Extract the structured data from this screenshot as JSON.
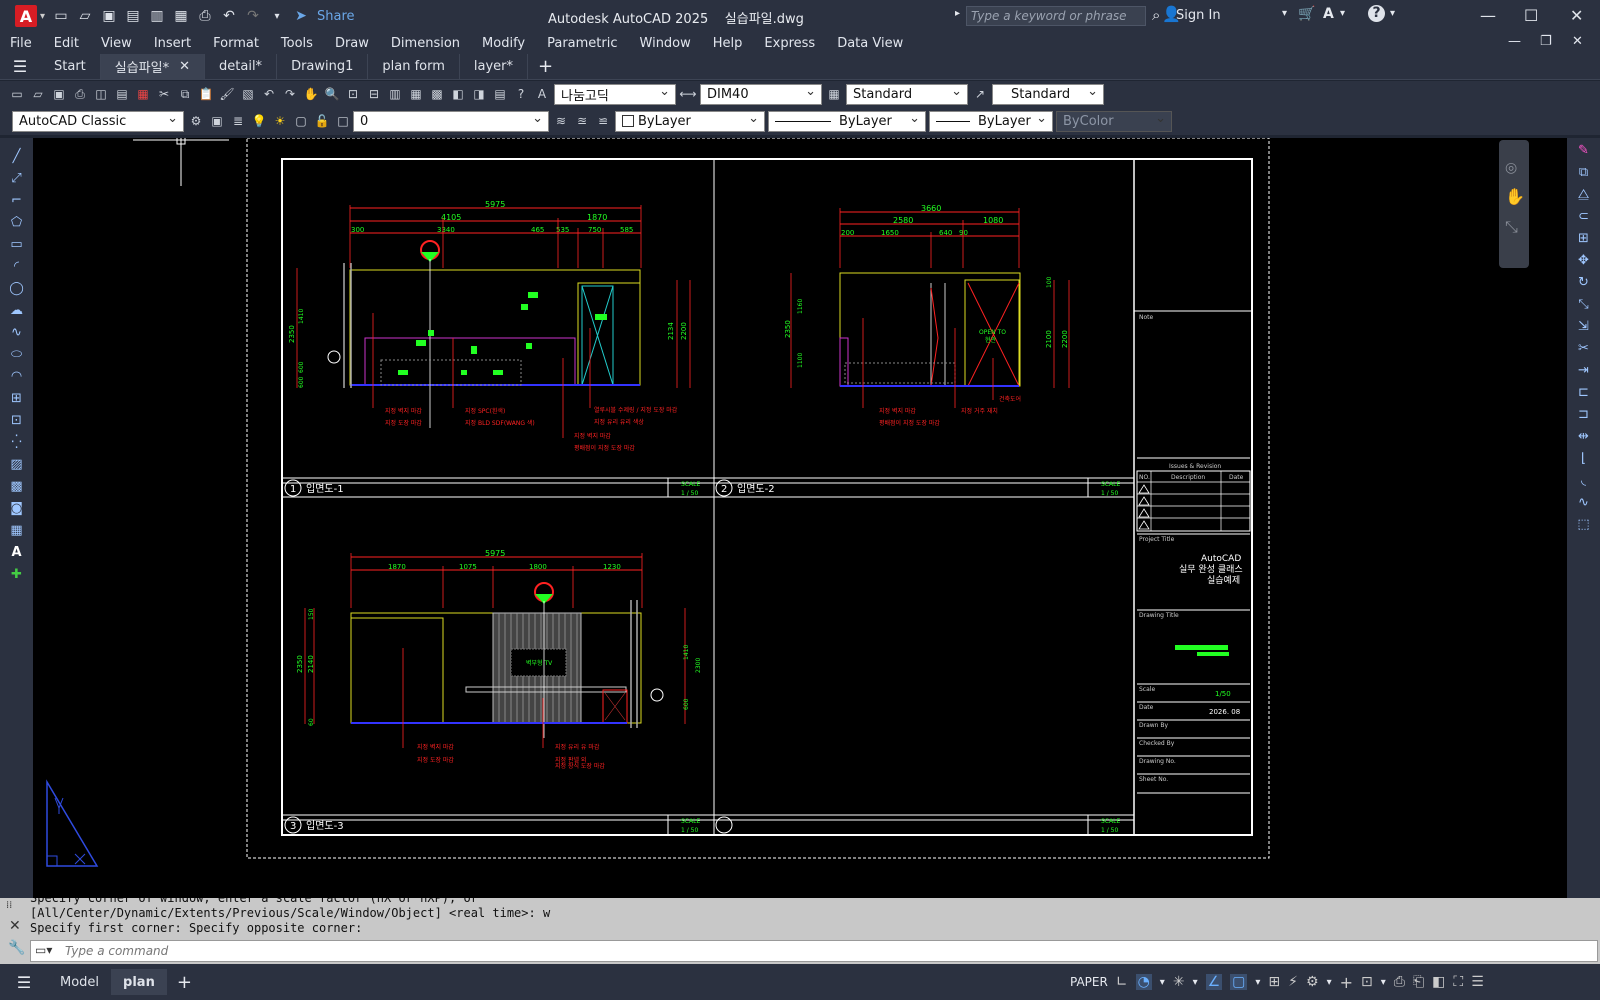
{
  "app": {
    "title": "Autodesk AutoCAD 2025",
    "file": "실습파일.dwg",
    "share": "Share",
    "search_placeholder": "Type a keyword or phrase",
    "sign_in": "Sign In"
  },
  "menu": [
    "File",
    "Edit",
    "View",
    "Insert",
    "Format",
    "Tools",
    "Draw",
    "Dimension",
    "Modify",
    "Parametric",
    "Window",
    "Help",
    "Express",
    "Data View"
  ],
  "tabs": [
    "Start",
    "실습파일*",
    "detail*",
    "Drawing1",
    "plan form",
    "layer*"
  ],
  "toolbar1": {
    "text_style": "나눔고딕",
    "dim_style": "DIM40",
    "table_style": "Standard",
    "mleader_style": "Standard"
  },
  "toolbar2": {
    "workspace": "AutoCAD Classic",
    "layer": "0",
    "color": "ByLayer",
    "linetype": "ByLayer",
    "lineweight": "ByLayer",
    "plotstyle": "ByColor"
  },
  "drawing": {
    "views": [
      {
        "num": "1",
        "title": "입면도-1",
        "scale_label": "SCALE",
        "scale": "1 / 50"
      },
      {
        "num": "2",
        "title": "입면도-2",
        "scale_label": "SCALE",
        "scale": "1 / 50"
      },
      {
        "num": "3",
        "title": "입면도-3",
        "scale_label": "SCALE",
        "scale": "1 / 50"
      },
      {
        "num": "",
        "title": "",
        "scale_label": "SCALE",
        "scale": "1 / 50"
      }
    ],
    "dims1_top": [
      "5975"
    ],
    "dims1_mid": [
      "4105",
      "1870"
    ],
    "dims1_low": [
      "300",
      "3340",
      "465",
      "535",
      "750",
      "585"
    ],
    "dims1_right": [
      "2134",
      "2200"
    ],
    "dims1_left": [
      "2350",
      "1410",
      "600",
      "600"
    ],
    "notes1": [
      "지정 벽지 마감",
      "지정 도장 마감",
      "지정 SPC(흰색)",
      "지정 BLD SDF(WANG 색)",
      "열루시블 수제링 / 지정 도장 마감",
      "지정 유리 유리 색상",
      "지정 벽지 마감",
      "평배점이 지정 도장 마감"
    ],
    "dims2_top": [
      "3660"
    ],
    "dims2_mid": [
      "2580",
      "1080"
    ],
    "dims2_low": [
      "200",
      "1650",
      "640",
      "90"
    ],
    "dims2_right": [
      "2100",
      "2200"
    ],
    "dims2_left": [
      "2350",
      "1160",
      "1100",
      "100"
    ],
    "notes2": [
      "지정 벽지 마감",
      "평배점이 지정 도장 마감",
      "지정 거주 재치",
      "건축도어"
    ],
    "door_label": [
      "OPEN TO",
      "현관"
    ],
    "dims3_top": [
      "5975"
    ],
    "dims3_low": [
      "1870",
      "1075",
      "1800",
      "1230"
    ],
    "dims3_left": [
      "2350",
      "2140",
      "150",
      "60"
    ],
    "dims3_right": [
      "1410",
      "2300",
      "600"
    ],
    "tv_label": "벽부형 TV",
    "notes3": [
      "지정 벽지 마감",
      "지정 도장 마감",
      "지정 유리 유 마감",
      "지정 판넬 외",
      "지정 장식 도장 마감"
    ],
    "titleblock": {
      "note": "Note",
      "issues": "Issues & Revision",
      "no": "NO.",
      "desc": "Description",
      "date_col": "Date",
      "project_title": "Project Title",
      "project": [
        "AutoCAD",
        "실무 완성 클래스",
        "실습예제"
      ],
      "drawing_title": "Drawing Title",
      "scale_label": "Scale",
      "scale": "1/50",
      "date_label": "Date",
      "date": "2026. 08",
      "drawn_by": "Drawn By",
      "checked_by": "Checked By",
      "drawing_no": "Drawing No.",
      "sheet_no": "Sheet No."
    }
  },
  "command": {
    "history": [
      "Specify corner of window, enter a scale factor (nX or nXP), or",
      "[All/Center/Dynamic/Extents/Previous/Scale/Window/Object] <real time>: w",
      "Specify first corner: Specify opposite corner:"
    ],
    "placeholder": "Type a command"
  },
  "status": {
    "model_tab": "Model",
    "layout_tab": "plan",
    "space": "PAPER"
  }
}
